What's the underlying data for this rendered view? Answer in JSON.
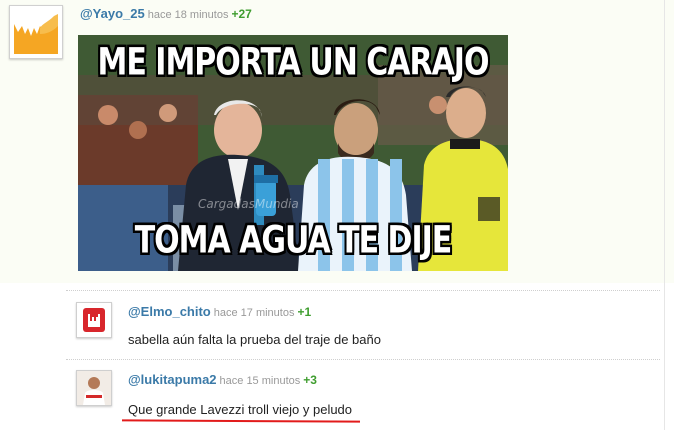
{
  "main_post": {
    "username": "@Yayo_25",
    "time": "hace 18 minutos",
    "votes": "+27",
    "meme": {
      "top_text": "ME IMPORTA UN CARAJO",
      "bottom_text": "TOMA AGUA TE DIJE",
      "watermark": "CargadasMundia"
    }
  },
  "replies": [
    {
      "username": "@Elmo_chito",
      "time": "hace 17 minutos",
      "votes": "+1",
      "text": "sabella aún falta la prueba del traje de baño"
    },
    {
      "username": "@lukitapuma2",
      "time": "hace 15 minutos",
      "votes": "+3",
      "text": "Que grande Lavezzi troll viejo y peludo"
    }
  ],
  "colors": {
    "username": "#3b7aa8",
    "votes": "#3f9d2f",
    "highlight": "#e21b1b"
  }
}
